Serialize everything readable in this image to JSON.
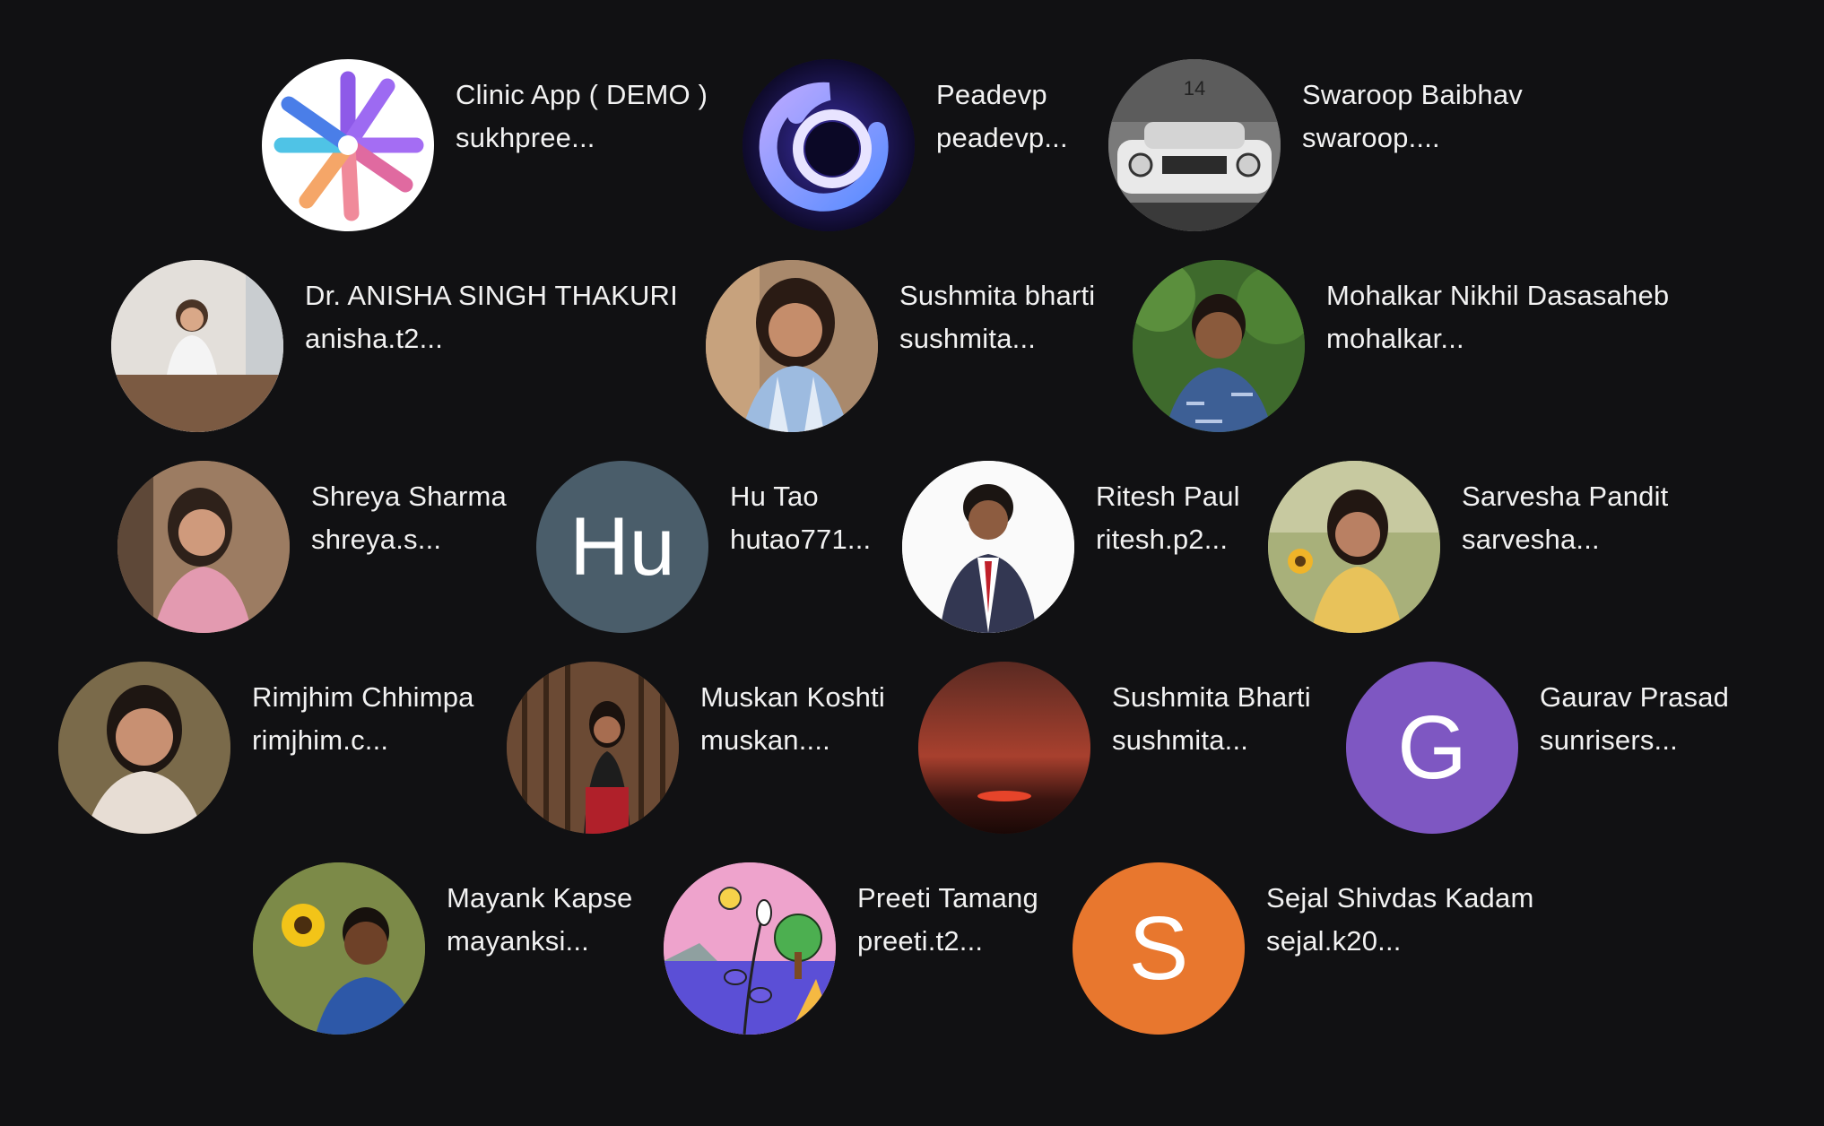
{
  "participants": [
    {
      "name": "Clinic App ( DEMO )",
      "email": "sukhpree...",
      "avatar": "clinic-logo-icon"
    },
    {
      "name": "Peadevp",
      "email": "peadevp...",
      "avatar": "crescent-logo-icon"
    },
    {
      "name": "Swaroop Baibhav",
      "email": "swaroop....",
      "avatar": "car-photo"
    },
    {
      "name": "Dr. ANISHA SINGH THAKURI",
      "email": "anisha.t2...",
      "avatar": "photo"
    },
    {
      "name": "Sushmita bharti",
      "email": "sushmita...",
      "avatar": "photo"
    },
    {
      "name": "Mohalkar Nikhil Dasasaheb",
      "email": "mohalkar...",
      "avatar": "photo"
    },
    {
      "name": "Shreya Sharma",
      "email": "shreya.s...",
      "avatar": "photo"
    },
    {
      "name": "Hu Tao",
      "email": "hutao771...",
      "avatar_initials": "Hu",
      "avatar_color": "#4a5d6a"
    },
    {
      "name": "Ritesh Paul",
      "email": "ritesh.p2...",
      "avatar": "photo"
    },
    {
      "name": "Sarvesha Pandit",
      "email": "sarvesha...",
      "avatar": "photo"
    },
    {
      "name": "Rimjhim Chhimpa",
      "email": "rimjhim.c...",
      "avatar": "photo"
    },
    {
      "name": "Muskan Koshti",
      "email": "muskan....",
      "avatar": "photo"
    },
    {
      "name": "Sushmita Bharti",
      "email": "sushmita...",
      "avatar": "sunset-photo"
    },
    {
      "name": "Gaurav Prasad",
      "email": "sunrisers...",
      "avatar_initials": "G",
      "avatar_color": "#7e57c2"
    },
    {
      "name": "Mayank Kapse",
      "email": "mayanksi...",
      "avatar": "photo"
    },
    {
      "name": "Preeti Tamang",
      "email": "preeti.t2...",
      "avatar": "illustration"
    },
    {
      "name": "Sejal Shivdas Kadam",
      "email": "sejal.k20...",
      "avatar_initials": "S",
      "avatar_color": "#e8772e"
    }
  ]
}
